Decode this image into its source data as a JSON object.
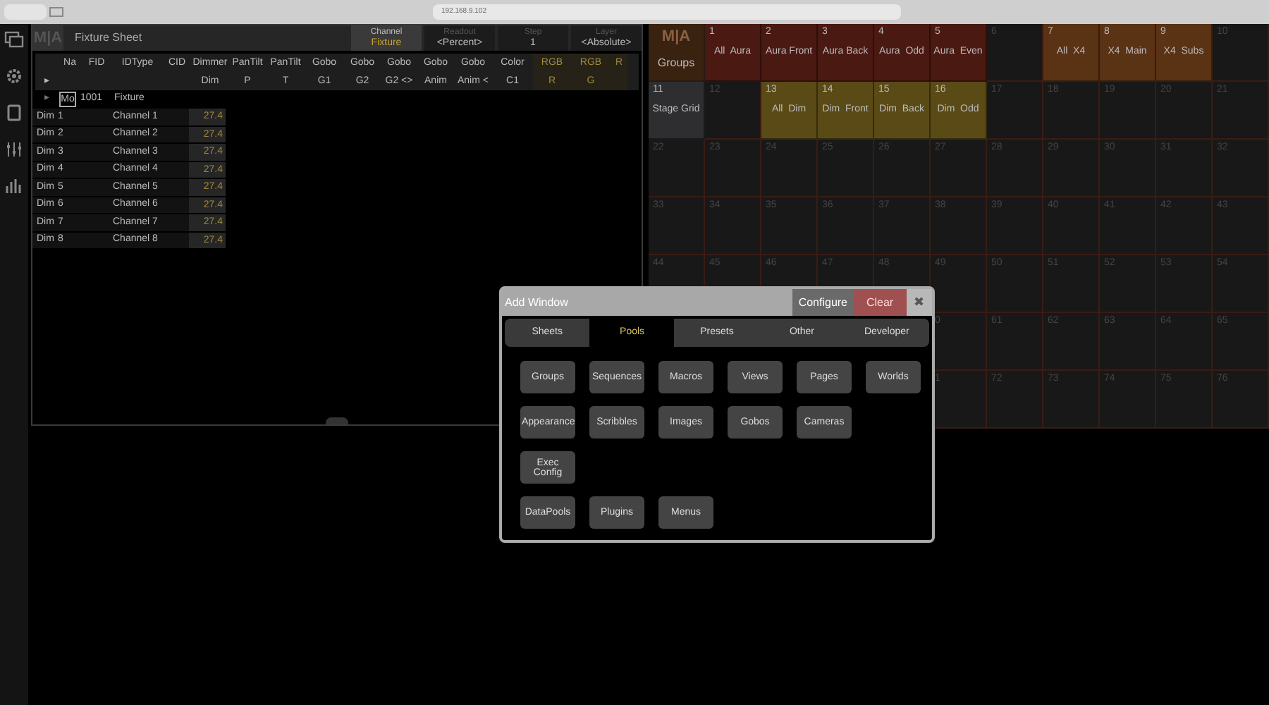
{
  "browser": {
    "address": "192.168.9.102"
  },
  "sidebar": {
    "items": [
      {
        "kind": "windows"
      },
      {
        "kind": "gear"
      },
      {
        "kind": "square"
      },
      {
        "kind": "faders"
      },
      {
        "kind": "bars"
      }
    ]
  },
  "fixture_sheet": {
    "logo": "M|A",
    "title": "Fixture Sheet",
    "controls": [
      {
        "label": "Channel",
        "value": "Fixture",
        "active": true
      },
      {
        "label": "Readout",
        "value": "<Percent>",
        "active": false
      },
      {
        "label": "Step",
        "value": "1",
        "active": false
      },
      {
        "label": "Layer",
        "value": "<Absolute>",
        "active": false
      }
    ],
    "columns": [
      {
        "bottom": "▸"
      },
      {
        "top": "Na"
      },
      {
        "top": "FID"
      },
      {
        "top": "IDType"
      },
      {
        "top": "CID"
      },
      {
        "top": "Dimmer",
        "bottom": "Dim"
      },
      {
        "top": "PanTilt",
        "bottom": "P"
      },
      {
        "top": "PanTilt",
        "bottom": "T"
      },
      {
        "top": "Gobo",
        "bottom": "G1"
      },
      {
        "top": "Gobo",
        "bottom": "G2"
      },
      {
        "top": "Gobo",
        "bottom": "G2 <>"
      },
      {
        "top": "Gobo",
        "bottom": "Anim"
      },
      {
        "top": "Gobo",
        "bottom": "Anim <"
      },
      {
        "top": "Color",
        "bottom": "C1"
      },
      {
        "top": "RGB",
        "bottom": "R"
      },
      {
        "top": "RGB",
        "bottom": "G"
      },
      {
        "top": "R"
      }
    ],
    "fixture_row": {
      "arrow": "▸",
      "name": "Mo",
      "fid": "1001",
      "idtype": "Fixture"
    },
    "rows": [
      {
        "name": "Dim",
        "cid": "1",
        "idtype": "Channel 1",
        "dimmer": "27.4"
      },
      {
        "name": "Dim",
        "cid": "2",
        "idtype": "Channel 2",
        "dimmer": "27.4"
      },
      {
        "name": "Dim",
        "cid": "3",
        "idtype": "Channel 3",
        "dimmer": "27.4"
      },
      {
        "name": "Dim",
        "cid": "4",
        "idtype": "Channel 4",
        "dimmer": "27.4"
      },
      {
        "name": "Dim",
        "cid": "5",
        "idtype": "Channel 5",
        "dimmer": "27.4"
      },
      {
        "name": "Dim",
        "cid": "6",
        "idtype": "Channel 6",
        "dimmer": "27.4"
      },
      {
        "name": "Dim",
        "cid": "7",
        "idtype": "Channel 7",
        "dimmer": "27.4"
      },
      {
        "name": "Dim",
        "cid": "8",
        "idtype": "Channel 8",
        "dimmer": "27.4"
      }
    ]
  },
  "groups_pool": {
    "rows": [
      [
        {
          "kind": "title",
          "logo": "M|A",
          "label": "Groups"
        },
        {
          "number": "1",
          "label": "All  Aura",
          "color": "#4a1912"
        },
        {
          "number": "2",
          "label": "Aura Front",
          "color": "#4a1912"
        },
        {
          "number": "3",
          "label": "Aura Back",
          "color": "#4a1912"
        },
        {
          "number": "4",
          "label": "Aura  Odd",
          "color": "#4a1912"
        },
        {
          "number": "5",
          "label": "Aura  Even",
          "color": "#4a1912"
        },
        {
          "number": "6"
        },
        {
          "number": "7",
          "label": "All  X4",
          "color": "#5a3214"
        },
        {
          "number": "8",
          "label": "X4  Main",
          "color": "#5a3214"
        },
        {
          "number": "9",
          "label": "X4  Subs",
          "color": "#5a3214"
        },
        {
          "number": "10"
        }
      ],
      [
        {
          "number": "11",
          "label": "Stage Grid",
          "color": "#2e2e30"
        },
        {
          "number": "12"
        },
        {
          "number": "13",
          "label": "All  Dim",
          "color": "#5a4a16"
        },
        {
          "number": "14",
          "label": "Dim  Front",
          "color": "#5a4a16"
        },
        {
          "number": "15",
          "label": "Dim  Back",
          "color": "#5a4a16"
        },
        {
          "number": "16",
          "label": "Dim  Odd",
          "color": "#5a4a16"
        },
        {
          "number": "17"
        },
        {
          "number": "18"
        },
        {
          "number": "19"
        },
        {
          "number": "20"
        },
        {
          "number": "21"
        }
      ],
      [
        {
          "number": "22"
        },
        {
          "number": "23"
        },
        {
          "number": "24"
        },
        {
          "number": "25"
        },
        {
          "number": "26"
        },
        {
          "number": "27"
        },
        {
          "number": "28"
        },
        {
          "number": "29"
        },
        {
          "number": "30"
        },
        {
          "number": "31"
        },
        {
          "number": "32"
        }
      ],
      [
        {
          "number": "33"
        },
        {
          "number": "34"
        },
        {
          "number": "35"
        },
        {
          "number": "36"
        },
        {
          "number": "37"
        },
        {
          "number": "38"
        },
        {
          "number": "39"
        },
        {
          "number": "40"
        },
        {
          "number": "41"
        },
        {
          "number": "42"
        },
        {
          "number": "43"
        }
      ],
      [
        {
          "number": "44"
        },
        {
          "number": "45"
        },
        {
          "number": "46"
        },
        {
          "number": "47"
        },
        {
          "number": "48"
        },
        {
          "number": "49"
        },
        {
          "number": "50"
        },
        {
          "number": "51"
        },
        {
          "number": "52"
        },
        {
          "number": "53"
        },
        {
          "number": "54"
        }
      ],
      [
        {},
        {},
        {},
        {},
        {},
        {
          "number": "0"
        },
        {
          "number": "61"
        },
        {
          "number": "62"
        },
        {
          "number": "63"
        },
        {
          "number": "64"
        },
        {
          "number": "65"
        }
      ],
      [
        {},
        {},
        {},
        {},
        {},
        {
          "number": "1"
        },
        {
          "number": "72"
        },
        {
          "number": "73"
        },
        {
          "number": "74"
        },
        {
          "number": "75"
        },
        {
          "number": "76"
        }
      ]
    ]
  },
  "add_window": {
    "title": "Add Window",
    "configure": "Configure",
    "clear": "Clear",
    "close": "✖",
    "tabs": [
      {
        "label": "Sheets",
        "selected": false
      },
      {
        "label": "Pools",
        "selected": true
      },
      {
        "label": "Presets",
        "selected": false
      },
      {
        "label": "Other",
        "selected": false
      },
      {
        "label": "Developer",
        "selected": false
      }
    ],
    "button_rows": [
      [
        "Groups",
        "Sequences",
        "Macros",
        "Views",
        "Pages",
        "Worlds"
      ],
      [
        "Appearance",
        "Scribbles",
        "Images",
        "Gobos",
        "Cameras"
      ],
      [
        "Exec Config"
      ],
      [
        "DataPools",
        "Plugins",
        "Menus"
      ]
    ]
  }
}
